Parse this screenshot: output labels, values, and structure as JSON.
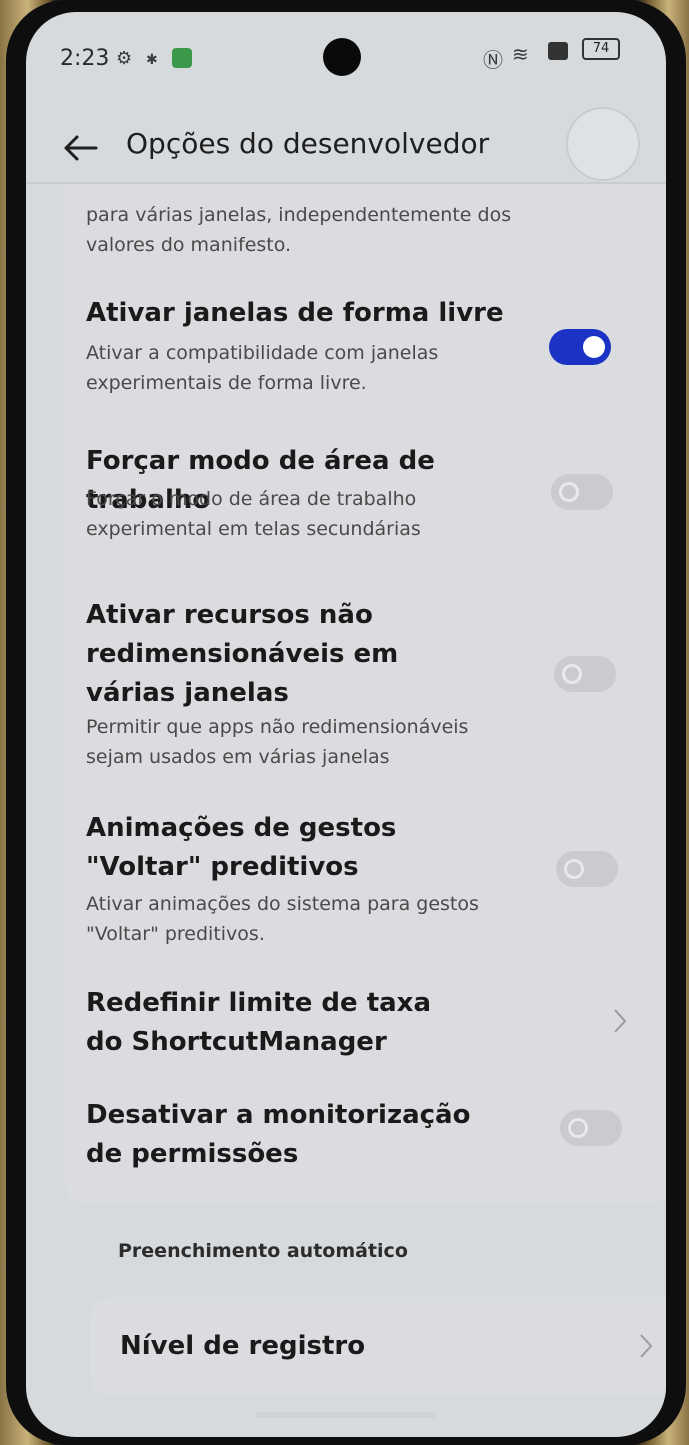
{
  "status_bar": {
    "time": "2:23",
    "battery": "74",
    "icons": [
      "settings-status-icon",
      "bug-status-icon",
      "app-status-icon",
      "nfc-icon",
      "wifi-icon",
      "sim-icon",
      "battery-icon"
    ]
  },
  "header": {
    "title": "Opções do desenvolvedor",
    "back_icon": "arrow-left-icon"
  },
  "partial_text": {
    "text": "para várias janelas, independentemente dos valores do manifesto."
  },
  "settings": [
    {
      "title": "Ativar janelas de forma livre",
      "subtitle": "Ativar a compatibilidade com janelas experimentais de forma livre.",
      "control": "toggle",
      "enabled": true
    },
    {
      "title": "Forçar modo de área de trabalho",
      "subtitle": "Forçar o modo de área de trabalho experimental em telas secundárias",
      "control": "toggle",
      "enabled": false
    },
    {
      "title": "Ativar recursos não redimensionáveis em várias janelas",
      "subtitle": "Permitir que apps não redimensionáveis sejam usados em várias janelas",
      "control": "toggle",
      "enabled": false
    },
    {
      "title": "Animações de gestos \"Voltar\" preditivos",
      "subtitle": "Ativar animações do sistema para gestos \"Voltar\" preditivos.",
      "control": "toggle",
      "enabled": false
    },
    {
      "title": "Redefinir limite de taxa do ShortcutManager",
      "subtitle": "",
      "control": "chevron"
    },
    {
      "title": "Desativar a monitorização de permissões",
      "subtitle": "",
      "control": "toggle",
      "enabled": false
    }
  ],
  "section": {
    "label": "Preenchimento automático"
  },
  "log_level": {
    "title": "Nível de registro"
  },
  "colors": {
    "toggle_on": "#1a33c4",
    "toggle_off": "#c9cbce",
    "screen_bg": "#d7dadd"
  }
}
